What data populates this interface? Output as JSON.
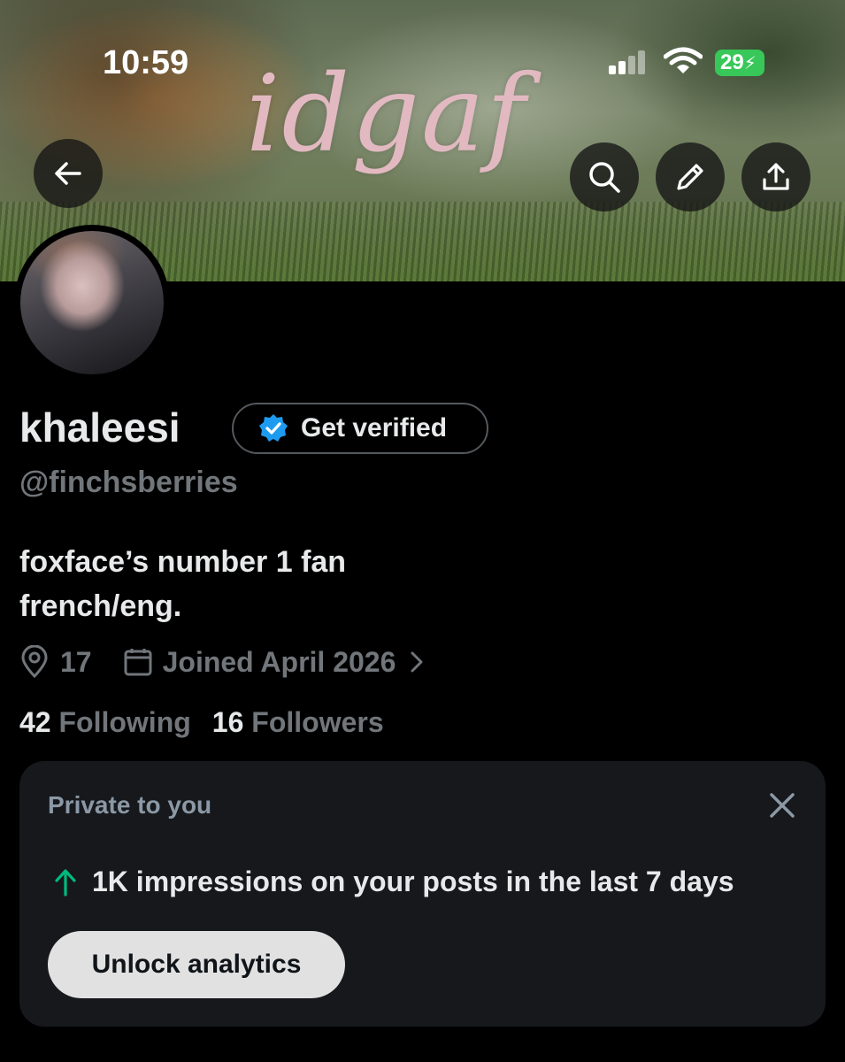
{
  "status_bar": {
    "time": "10:59",
    "battery": "29"
  },
  "header": {
    "banner_text": "idgaf",
    "buttons": {
      "back_icon": "arrow-left-icon",
      "search_icon": "search-icon",
      "edit_icon": "pencil-icon",
      "share_icon": "share-icon"
    }
  },
  "profile": {
    "display_name": "khaleesi",
    "get_verified_label": "Get verified",
    "handle": "@finchsberries",
    "bio_lines": [
      "foxface’s number 1 fan",
      "french/eng."
    ],
    "location": "17",
    "joined": "Joined April 2026",
    "following_count": "42",
    "following_label": "Following",
    "followers_count": "16",
    "followers_label": "Followers"
  },
  "insight_card": {
    "title": "Private to you",
    "stat": "1K impressions on your posts in the last 7 days",
    "button_label": "Unlock analytics"
  },
  "colors": {
    "background": "#000000",
    "primary_text": "#e7e9ea",
    "secondary_text": "#71767b",
    "verified_blue": "#1d9bf0",
    "trend_green": "#00ba7c",
    "battery_green": "#38c759",
    "card_bg": "#16181c"
  }
}
